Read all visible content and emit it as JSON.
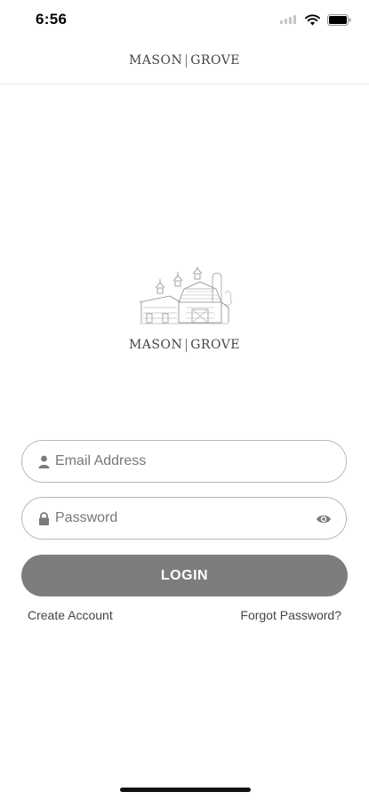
{
  "status_bar": {
    "time": "6:56"
  },
  "header": {
    "brand_left": "MASON",
    "brand_right": "GROVE"
  },
  "logo": {
    "brand_left": "MASON",
    "brand_right": "GROVE"
  },
  "form": {
    "email_placeholder": "Email Address",
    "password_placeholder": "Password",
    "login_label": "LOGIN"
  },
  "links": {
    "create_account": "Create Account",
    "forgot_password": "Forgot Password?"
  },
  "icons": [
    "signal-icon",
    "wifi-icon",
    "battery-icon",
    "user-icon",
    "lock-icon",
    "eye-icon"
  ],
  "colors": {
    "button": "#7d7d7d",
    "field_border": "#b8b8b8",
    "background": "#ffffff"
  }
}
